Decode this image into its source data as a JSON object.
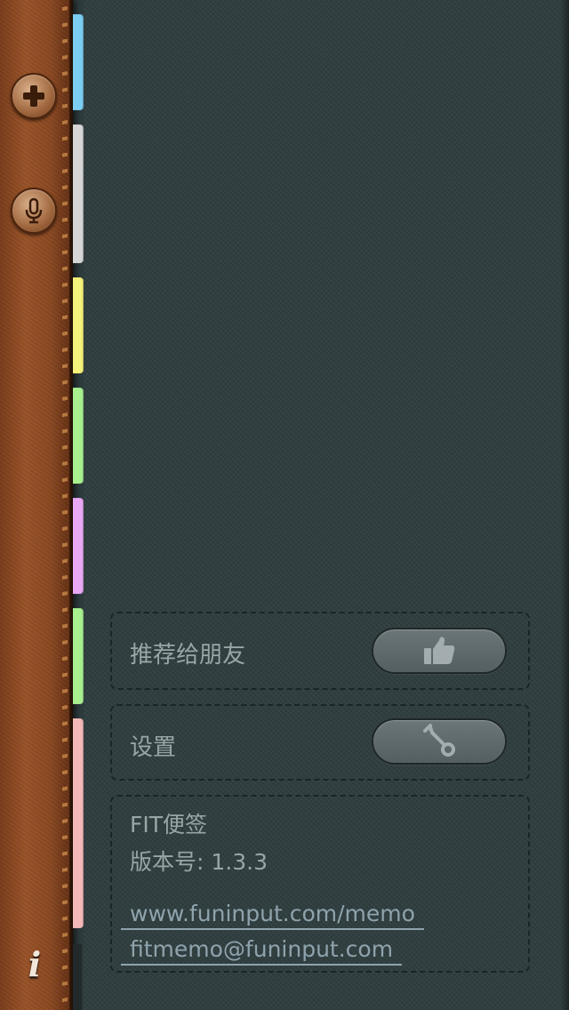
{
  "sidebar": {
    "add_icon": "plus-icon",
    "mic_icon": "microphone-icon",
    "info_label": "i"
  },
  "tabs": [
    {
      "color": "#7ccdf2"
    },
    {
      "color": "#d6d6d6"
    },
    {
      "color": "#f4f27a"
    },
    {
      "color": "#a8ef90"
    },
    {
      "color": "#e9a8f4"
    },
    {
      "color": "#a8ef90"
    },
    {
      "color": "#f4b8b8"
    }
  ],
  "recommend": {
    "label": "推荐给朋友",
    "button_icon": "thumbs-up-icon"
  },
  "settings": {
    "label": "设置",
    "button_icon": "wrench-icon"
  },
  "about": {
    "app_name": "FIT便签",
    "version": "版本号: 1.3.3",
    "website": "www.funinput.com/memo",
    "email": "fitmemo@funinput.com"
  }
}
